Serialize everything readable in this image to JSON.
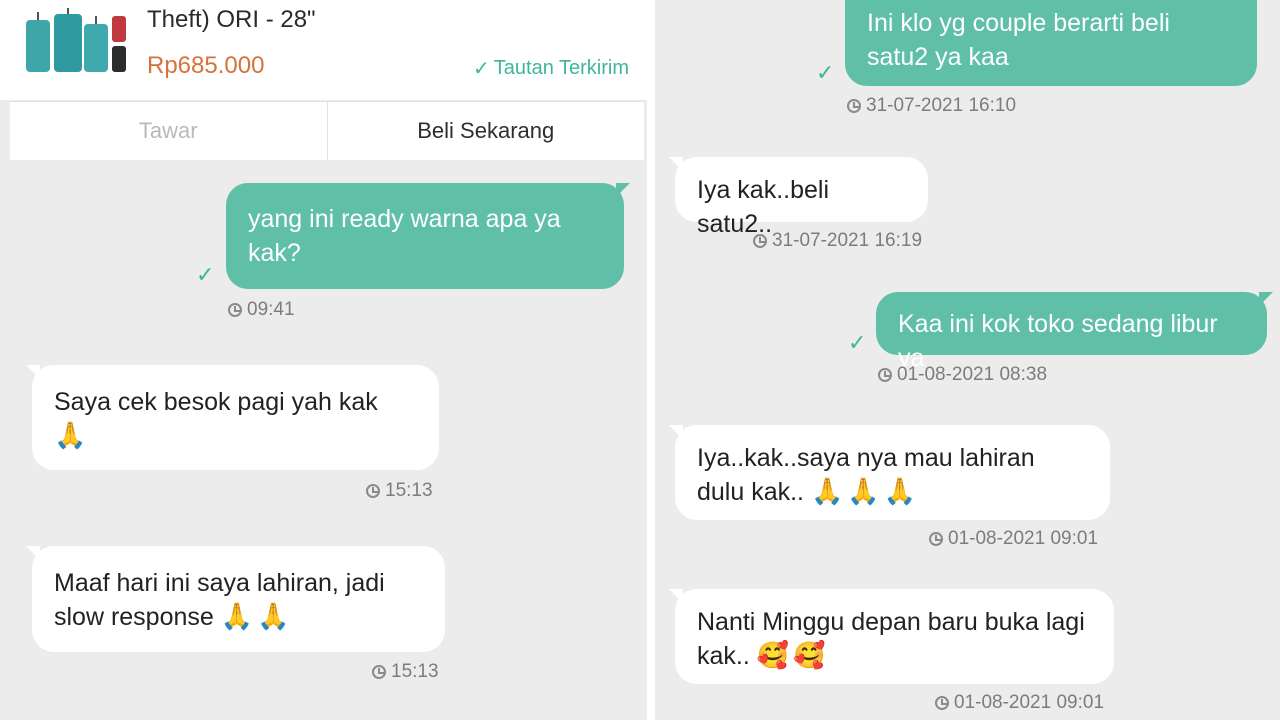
{
  "left_panel": {
    "product": {
      "title": "Theft) ORI - 28\"",
      "price": "Rp685.000",
      "sent_label": "Tautan Terkirim",
      "thumb_icon": "luggage-image",
      "colors": {
        "accent": "#5fbfa7",
        "price": "#d5733a"
      }
    },
    "actions": {
      "tawar": "Tawar",
      "beli": "Beli Sekarang"
    },
    "messages": [
      {
        "direction": "out",
        "text": "yang ini ready warna apa ya kak?",
        "time": "09:41"
      },
      {
        "direction": "in",
        "text": "Saya cek besok pagi yah kak",
        "emoji": "🙏",
        "time": "15:13"
      },
      {
        "direction": "in",
        "text": "Maaf hari ini saya lahiran, jadi slow response",
        "emoji": "🙏🙏",
        "time": "15:13"
      }
    ]
  },
  "right_panel": {
    "messages": [
      {
        "direction": "out",
        "text": "Ini klo yg couple berarti beli satu2 ya kaa",
        "time": "31-07-2021 16:10"
      },
      {
        "direction": "in",
        "text": "Iya kak..beli satu2..",
        "time": "31-07-2021 16:19"
      },
      {
        "direction": "out",
        "text": "Kaa ini kok toko sedang libur ya",
        "time": "01-08-2021 08:38"
      },
      {
        "direction": "in",
        "text": "Iya..kak..saya nya mau lahiran dulu kak..",
        "emoji": "🙏🙏🙏",
        "time": "01-08-2021 09:01"
      },
      {
        "direction": "in",
        "text": "Nanti Minggu depan baru buka lagi kak..",
        "emoji": "🥰🥰",
        "time": "01-08-2021 09:01"
      }
    ]
  },
  "icons": {
    "check": "check-icon",
    "clock": "clock-icon"
  }
}
